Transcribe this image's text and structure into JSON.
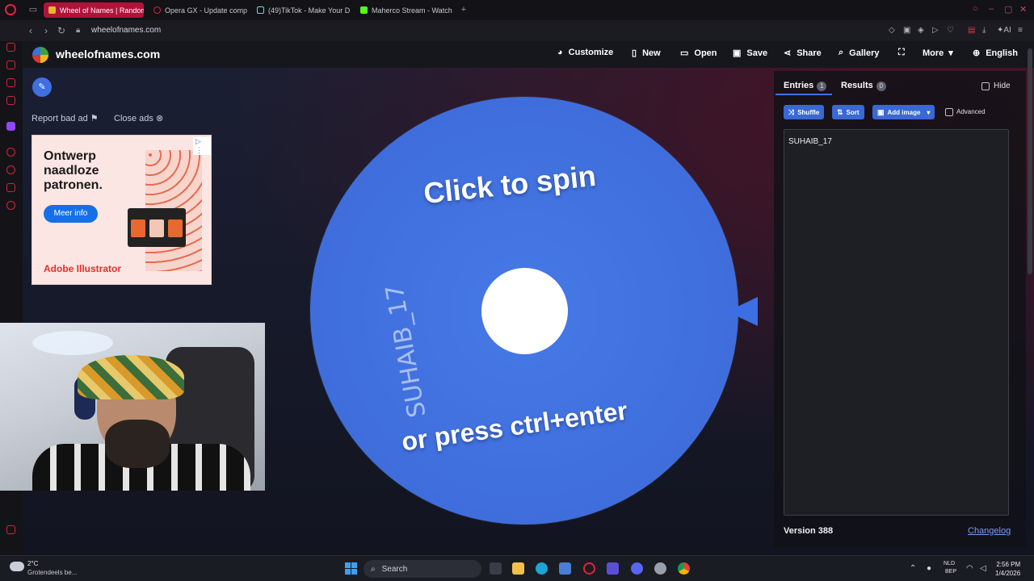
{
  "browser": {
    "tabs": [
      {
        "label": "Wheel of Names | Random",
        "active": true
      },
      {
        "label": "Opera GX - Update comp",
        "active": false
      },
      {
        "label": "(49)TikTok - Make Your D",
        "active": false
      },
      {
        "label": "Maherco Stream - Watch",
        "active": false
      }
    ],
    "url": "wheelofnames.com"
  },
  "site": {
    "logo_text": "wheelofnames.com",
    "nav": {
      "customize": "Customize",
      "new": "New",
      "open": "Open",
      "save": "Save",
      "share": "Share",
      "gallery": "Gallery",
      "more": "More",
      "language": "English"
    }
  },
  "ad": {
    "report": "Report bad ad",
    "close": "Close ads",
    "title": "Ontwerp naadloze patronen.",
    "cta": "Meer info",
    "brand": "Adobe Illustrator"
  },
  "wheel": {
    "prompt_top": "Click to spin",
    "prompt_bottom": "or press ctrl+enter",
    "entry_label": "SUHAIB_17",
    "color": "#3c6ad8"
  },
  "panel": {
    "tabs": {
      "entries": "Entries",
      "entries_count": "1",
      "results": "Results",
      "results_count": "0"
    },
    "hide_label": "Hide",
    "toolbar": {
      "shuffle": "Shuffle",
      "sort": "Sort",
      "add_image": "Add image",
      "advanced": "Advanced"
    },
    "entries_text": "SUHAIB_17",
    "version": "Version 388",
    "changelog": "Changelog"
  },
  "taskbar": {
    "temperature": "2°C",
    "weather": "Grotendeels be...",
    "search": "Search",
    "lang_top": "NLD",
    "lang_bottom": "BEP",
    "time": "2:56 PM",
    "date": "1/4/2026"
  }
}
